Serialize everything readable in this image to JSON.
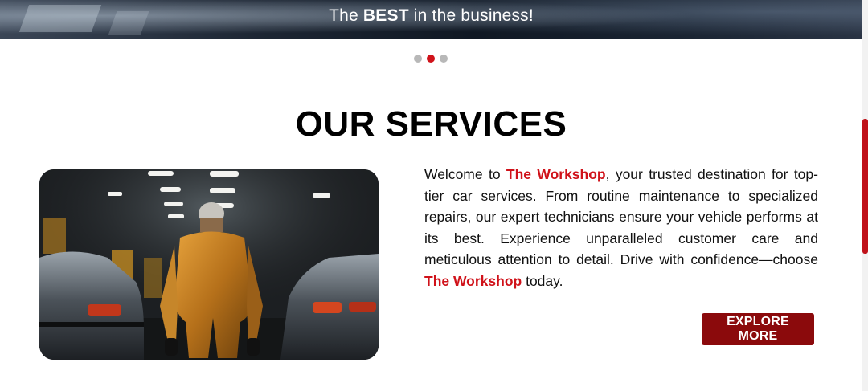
{
  "hero": {
    "text_before": "The ",
    "text_bold": "BEST",
    "text_after": " in the business!"
  },
  "carousel": {
    "dot_count": 3,
    "active_index": 1
  },
  "services": {
    "title": "OUR SERVICES",
    "paragraph": {
      "p1": "Welcome to ",
      "brand1": "The Workshop",
      "p2": ", your trusted destination for top-tier car services. From routine maintenance to specialized repairs, our expert technicians ensure your vehicle performs at its best. Experience unparalleled customer care and meticulous attention to detail. Drive with confidence—choose ",
      "brand2": "The Workshop",
      "p3": " today."
    },
    "button_label": "EXPLORE MORE",
    "image_subject": "mechanic-in-workshop"
  },
  "colors": {
    "accent": "#d0121a",
    "button": "#8b0a0c"
  }
}
